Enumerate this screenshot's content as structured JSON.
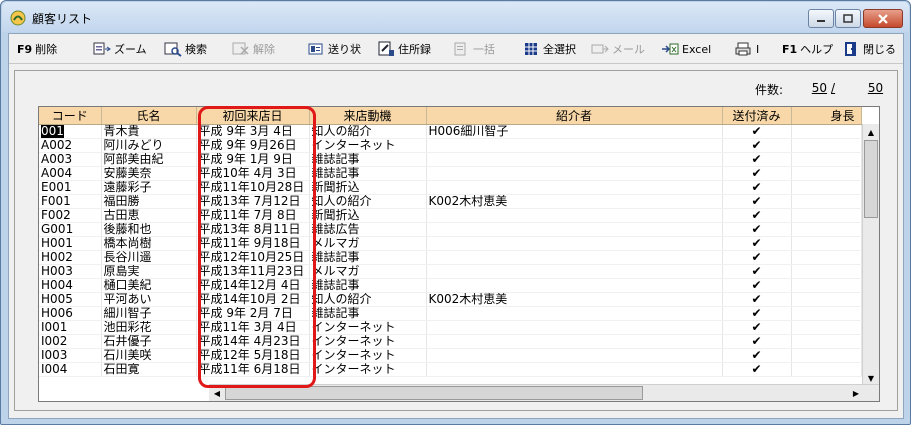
{
  "window": {
    "title": "顧客リスト"
  },
  "toolbar": {
    "items": [
      {
        "key": "F9",
        "label": "削除",
        "icon": "delete-icon",
        "disabled": false
      },
      {
        "key": "",
        "label": "ズーム",
        "icon": "zoom-icon",
        "disabled": false
      },
      {
        "key": "",
        "label": "検索",
        "icon": "search-icon",
        "disabled": false
      },
      {
        "key": "",
        "label": "解除",
        "icon": "clear-filter-icon",
        "disabled": true
      },
      {
        "key": "",
        "label": "送り状",
        "icon": "invoice-icon",
        "disabled": false
      },
      {
        "key": "",
        "label": "住所録",
        "icon": "address-book-icon",
        "disabled": false
      },
      {
        "key": "",
        "label": "一括",
        "icon": "batch-icon",
        "disabled": true
      },
      {
        "key": "",
        "label": "全選択",
        "icon": "select-all-icon",
        "disabled": false
      },
      {
        "key": "",
        "label": "メール",
        "icon": "mail-icon",
        "disabled": true
      },
      {
        "key": "",
        "label": "Excel",
        "icon": "excel-icon",
        "disabled": false
      },
      {
        "key": "",
        "label": "I",
        "icon": "print-icon",
        "disabled": false
      },
      {
        "key": "F1",
        "label": "ヘルプ",
        "icon": "help-icon",
        "disabled": false
      },
      {
        "key": "",
        "label": "閉じる",
        "icon": "close-door-icon",
        "disabled": false
      }
    ]
  },
  "count": {
    "label": "件数:",
    "current": "50",
    "sep": "/",
    "total": "50"
  },
  "columns": [
    "コード",
    "氏名",
    "初回来店日",
    "来店動機",
    "紹介者",
    "送付済み",
    "身長"
  ],
  "rows": [
    [
      "001",
      "青木貴",
      "平成 9年 3月 4日",
      "知人の紹介",
      "H006細川智子",
      "✔"
    ],
    [
      "A002",
      "阿川みどり",
      "平成 9年 9月26日",
      "インターネット",
      "",
      "✔"
    ],
    [
      "A003",
      "阿部美由紀",
      "平成 9年 1月 9日",
      "雑誌記事",
      "",
      "✔"
    ],
    [
      "A004",
      "安藤美奈",
      "平成10年 4月 3日",
      "雑誌記事",
      "",
      "✔"
    ],
    [
      "E001",
      "遠藤彩子",
      "平成11年10月28日",
      "新聞折込",
      "",
      "✔"
    ],
    [
      "F001",
      "福田勝",
      "平成13年 7月12日",
      "知人の紹介",
      "K002木村恵美",
      "✔"
    ],
    [
      "F002",
      "古田恵",
      "平成11年 7月 8日",
      "新聞折込",
      "",
      "✔"
    ],
    [
      "G001",
      "後藤和也",
      "平成13年 8月11日",
      "雑誌広告",
      "",
      "✔"
    ],
    [
      "H001",
      "橋本尚樹",
      "平成11年 9月18日",
      "メルマガ",
      "",
      "✔"
    ],
    [
      "H002",
      "長谷川遥",
      "平成12年10月25日",
      "雑誌記事",
      "",
      "✔"
    ],
    [
      "H003",
      "原島実",
      "平成13年11月23日",
      "メルマガ",
      "",
      "✔"
    ],
    [
      "H004",
      "樋口美紀",
      "平成14年12月 4日",
      "雑誌記事",
      "",
      "✔"
    ],
    [
      "H005",
      "平河あい",
      "平成14年10月 2日",
      "知人の紹介",
      "K002木村恵美",
      "✔"
    ],
    [
      "H006",
      "細川智子",
      "平成 9年 2月 7日",
      "雑誌記事",
      "",
      "✔"
    ],
    [
      "I001",
      "池田彩花",
      "平成11年 3月 4日",
      "インターネット",
      "",
      "✔"
    ],
    [
      "I002",
      "石井優子",
      "平成14年 4月23日",
      "インターネット",
      "",
      "✔"
    ],
    [
      "I003",
      "石川美咲",
      "平成12年 5月18日",
      "インターネット",
      "",
      "✔"
    ],
    [
      "I004",
      "石田寛",
      "平成11年 6月18日",
      "インターネット",
      "",
      "✔"
    ]
  ],
  "colors": {
    "header": "#f8d8a8",
    "highlight": "#e01818",
    "selection": "#000000"
  }
}
